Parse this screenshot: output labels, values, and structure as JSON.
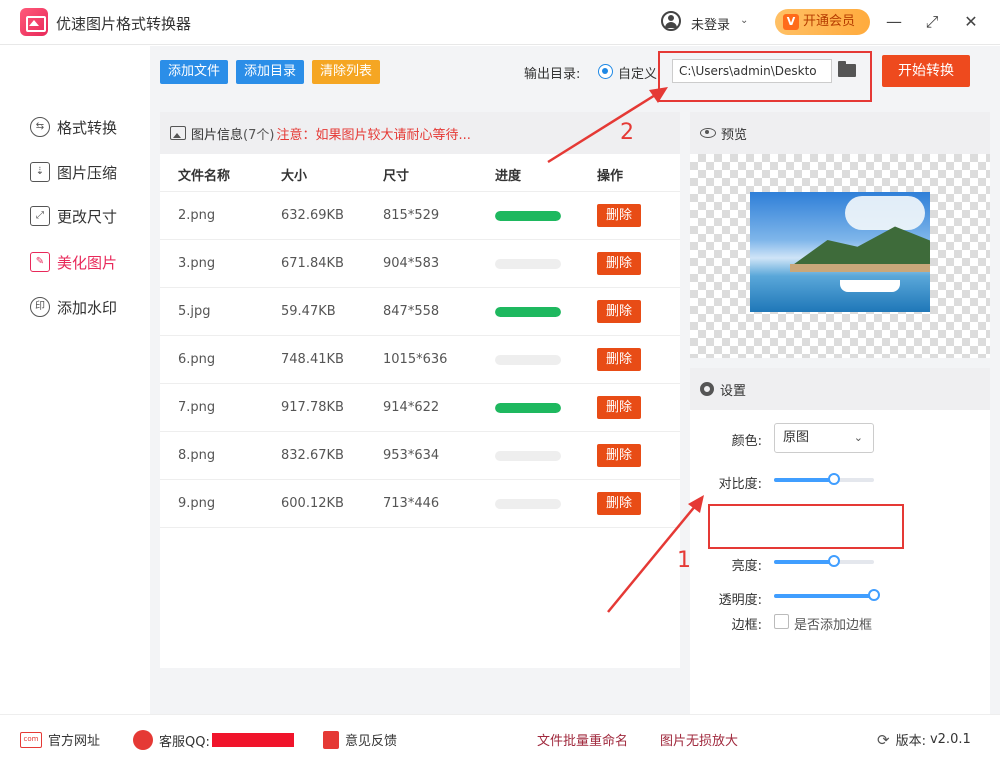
{
  "app": {
    "title": "优速图片格式转换器"
  },
  "titlebar": {
    "login_text": "未登录",
    "caret": "⌄",
    "vip_label": "开通会员",
    "vip_icon_text": "V",
    "minimize": "—",
    "maximize": "⤢",
    "close": "✕"
  },
  "sidebar": {
    "items": [
      {
        "label": "格式转换",
        "icon": "format-convert-icon",
        "glyph": "⇆"
      },
      {
        "label": "图片压缩",
        "icon": "compress-icon",
        "glyph": "⇣"
      },
      {
        "label": "更改尺寸",
        "icon": "resize-icon",
        "glyph": "⤢"
      },
      {
        "label": "美化图片",
        "icon": "beautify-icon",
        "glyph": "✎"
      },
      {
        "label": "添加水印",
        "icon": "watermark-icon",
        "glyph": "印"
      }
    ],
    "active_index": 3
  },
  "toolbar": {
    "add_file": "添加文件",
    "add_dir": "添加目录",
    "clear_list": "清除列表",
    "output_label": "输出目录:",
    "custom_label": "自定义",
    "output_path": "C:\\Users\\admin\\Deskto",
    "start_label": "开始转换"
  },
  "file_panel": {
    "title": "图片信息",
    "count": "(7个)",
    "warning": "注意：如果图片较大请耐心等待...",
    "columns": {
      "name": "文件名称",
      "size": "大小",
      "dim": "尺寸",
      "progress": "进度",
      "action": "操作"
    },
    "files": [
      {
        "name": "2.png",
        "size": "632.69KB",
        "dim": "815*529",
        "progress": 1,
        "action": "删除"
      },
      {
        "name": "3.png",
        "size": "671.84KB",
        "dim": "904*583",
        "progress": 0,
        "action": "删除"
      },
      {
        "name": "5.jpg",
        "size": "59.47KB",
        "dim": "847*558",
        "progress": 1,
        "action": "删除"
      },
      {
        "name": "6.png",
        "size": "748.41KB",
        "dim": "1015*636",
        "progress": 0,
        "action": "删除"
      },
      {
        "name": "7.png",
        "size": "917.78KB",
        "dim": "914*622",
        "progress": 1,
        "action": "删除"
      },
      {
        "name": "8.png",
        "size": "832.67KB",
        "dim": "953*634",
        "progress": 0,
        "action": "删除"
      },
      {
        "name": "9.png",
        "size": "600.12KB",
        "dim": "713*446",
        "progress": 0,
        "action": "删除"
      }
    ]
  },
  "preview": {
    "title": "预览"
  },
  "settings": {
    "title": "设置",
    "color_label": "颜色:",
    "color_value": "原图",
    "contrast_label": "对比度:",
    "contrast_value": 0.6,
    "brightness_label": "亮度:",
    "brightness_value": 0.6,
    "opacity_label": "透明度:",
    "opacity_value": 1.0,
    "border_label": "边框:",
    "border_checkbox": "是否添加边框"
  },
  "annotations": {
    "label_1": "1",
    "label_2": "2"
  },
  "footer": {
    "site": "官方网址",
    "site_icon_text": "com",
    "qq": "客服QQ:",
    "feedback": "意见反馈",
    "batch_rename": "文件批量重命名",
    "lossless": "图片无损放大",
    "version_label": "版本:",
    "version": "v2.0.1"
  },
  "colors": {
    "accent": "#e8295a",
    "start_button": "#ee4a1e",
    "delete_button": "#e84c16",
    "progress_fill": "#1eb85f",
    "slider": "#409eff",
    "add_file": "#2b8ee8",
    "clear_list": "#f5a623"
  }
}
